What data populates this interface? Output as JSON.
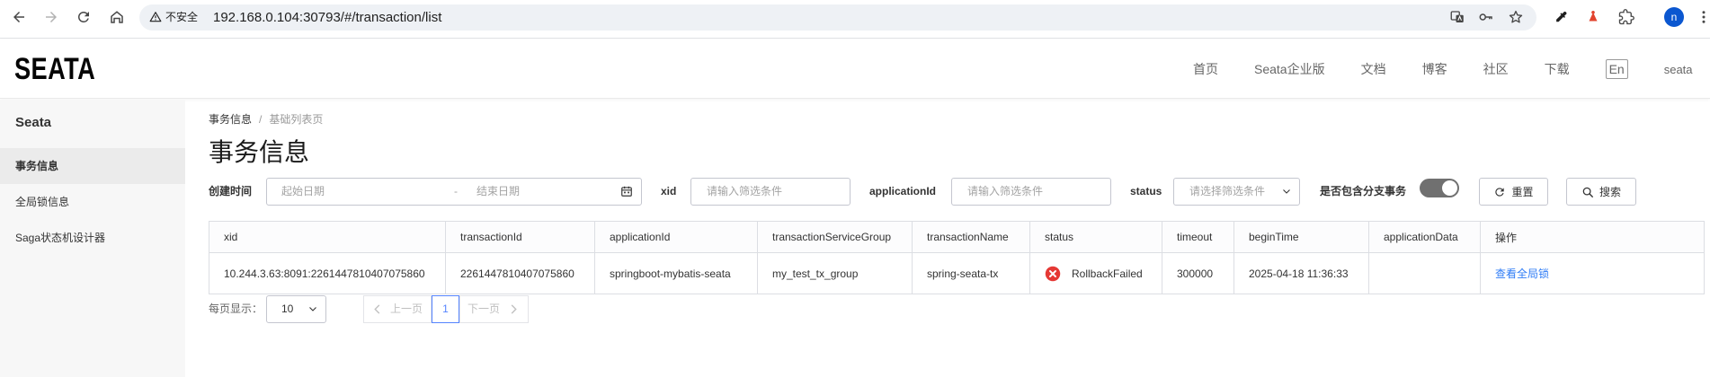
{
  "browser": {
    "security_label": "不安全",
    "url": "192.168.0.104:30793/#/transaction/list",
    "profile_initial": "n",
    "icons": [
      "back-icon",
      "forward-icon",
      "reload-icon",
      "home-icon",
      "warning-icon",
      "translate-icon",
      "key-icon",
      "star-icon",
      "eyedropper-icon",
      "extension-icon",
      "puzzle-icon",
      "more-vert-icon"
    ]
  },
  "header": {
    "logo_text": "SEATA",
    "nav": [
      "首页",
      "Seata企业版",
      "文档",
      "博客",
      "社区",
      "下载"
    ],
    "language_button": "En",
    "user_label": "seata"
  },
  "sidebar": {
    "title": "Seata",
    "items": [
      {
        "label": "事务信息",
        "active": true
      },
      {
        "label": "全局锁信息",
        "active": false
      },
      {
        "label": "Saga状态机设计器",
        "active": false
      }
    ]
  },
  "breadcrumb": {
    "items": [
      "事务信息",
      "基础列表页"
    ],
    "separator": "/"
  },
  "page_title": "事务信息",
  "filters": {
    "create_time_label": "创建时间",
    "start_date_placeholder": "起始日期",
    "range_separator": "-",
    "end_date_placeholder": "结束日期",
    "xid_label": "xid",
    "xid_placeholder": "请输入筛选条件",
    "application_id_label": "applicationId",
    "application_id_placeholder": "请输入筛选条件",
    "status_label": "status",
    "status_placeholder": "请选择筛选条件",
    "with_branch_label": "是否包含分支事务",
    "with_branch_checked": false,
    "reset_label": "重置",
    "search_label": "搜索",
    "icons": {
      "date": "calendar-icon",
      "status": "chevron-down-icon",
      "reset": "refresh-icon",
      "search": "search-icon"
    }
  },
  "table": {
    "columns": [
      "xid",
      "transactionId",
      "applicationId",
      "transactionServiceGroup",
      "transactionName",
      "status",
      "timeout",
      "beginTime",
      "applicationData",
      "操作"
    ],
    "rows": [
      {
        "xid": "10.244.3.63:8091:2261447810407075860",
        "transactionId": "2261447810407075860",
        "applicationId": "springboot-mybatis-seata",
        "transactionServiceGroup": "my_test_tx_group",
        "transactionName": "spring-seata-tx",
        "status": "RollbackFailed",
        "status_icon": "error-circle-icon",
        "timeout": "300000",
        "beginTime": "2025-04-18 11:36:33",
        "action": "查看全局锁"
      }
    ]
  },
  "pagination": {
    "page_size_label": "每页显示：",
    "page_size": "10",
    "prev_label": "上一页",
    "current_page": "1",
    "next_label": "下一页"
  },
  "colors": {
    "link": "#2f7cf6",
    "error_icon": "#e53935",
    "active_page": "#5584ff",
    "sidebar_bg": "#f7f7f7",
    "sidebar_active_bg": "#ebebeb",
    "avatar_bg": "#0b57d0"
  }
}
